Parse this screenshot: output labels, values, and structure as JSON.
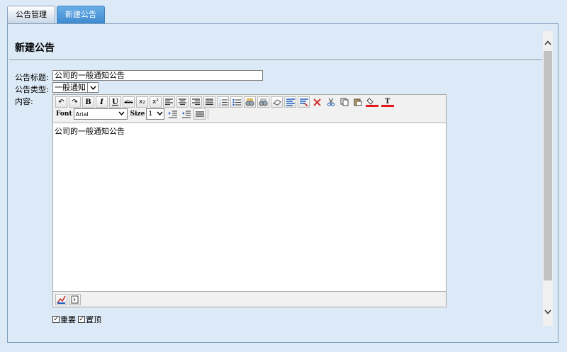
{
  "tabs": [
    {
      "label": "公告管理",
      "active": false
    },
    {
      "label": "新建公告",
      "active": true
    }
  ],
  "form": {
    "heading": "新建公告",
    "title_label": "公告标题:",
    "title_value": "公司的一般通知公告",
    "type_label": "公告类型:",
    "type_value": "一般通知",
    "content_label": "内容:",
    "content_text": "公司的一般通知公告"
  },
  "editor": {
    "font_label": "Font",
    "font_value": "Arial",
    "size_label": "Size",
    "size_value": "1",
    "toolbar_glyphs": {
      "undo": "↶",
      "redo": "↷",
      "bold": "B",
      "italic": "I",
      "underline": "U",
      "strike": "abc",
      "subscript": "x₂",
      "superscript": "x²"
    }
  },
  "options": {
    "important_label": "重要",
    "pin_label": "置顶",
    "important_checked": true,
    "pin_checked": true
  },
  "colors": {
    "tab_active": "#3d88cf",
    "background": "#dce9f6",
    "editor_bg": "#f1f1f1"
  }
}
